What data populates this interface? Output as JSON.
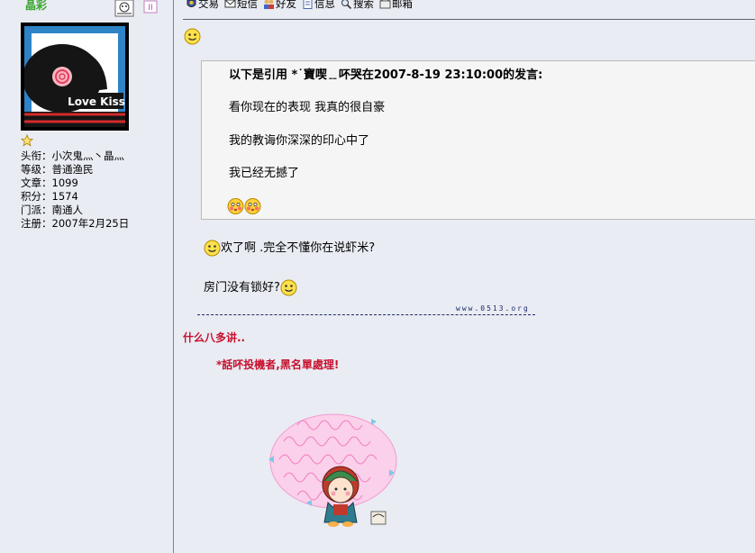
{
  "user": {
    "name": "晶彩",
    "avatar_caption": "Love Kiss",
    "profile": [
      {
        "label": "头衔",
        "value": "小次鬼灬丶晶灬"
      },
      {
        "label": "等级",
        "value": "普通渔民"
      },
      {
        "label": "文章",
        "value": "1099"
      },
      {
        "label": "积分",
        "value": "1574"
      },
      {
        "label": "门派",
        "value": "南通人"
      },
      {
        "label": "注册",
        "value": "2007年2月25日"
      }
    ]
  },
  "toolbar": {
    "items": [
      {
        "label": "交易",
        "icon": "trade-icon"
      },
      {
        "label": "短信",
        "icon": "envelope-icon"
      },
      {
        "label": "好友",
        "icon": "friends-icon"
      },
      {
        "label": "信息",
        "icon": "document-icon"
      },
      {
        "label": "搜索",
        "icon": "magnifier-icon"
      },
      {
        "label": "邮箱",
        "icon": "mailbox-icon"
      }
    ]
  },
  "quote": {
    "header": "以下是引用 *˙寶喫﹎吥哭在2007-8-19 23:10:00的发言:",
    "lines": [
      "看你现在的表现   我真的很自豪",
      "我的教诲你深深的印心中了",
      "我已经无撼了"
    ]
  },
  "reply": {
    "line1": "欢了啊 .完全不懂你在说虾米?",
    "line2": "房门没有锁好?"
  },
  "signature": {
    "url": "www.0513.org",
    "text1": "什么八多讲..",
    "text2": "*話吥投機者,黑名單處理!"
  },
  "colors": {
    "background": "#e9ecf3",
    "username": "#3aa52f",
    "signature_red": "#c8102e",
    "quote_bg": "#f5f5f5"
  }
}
